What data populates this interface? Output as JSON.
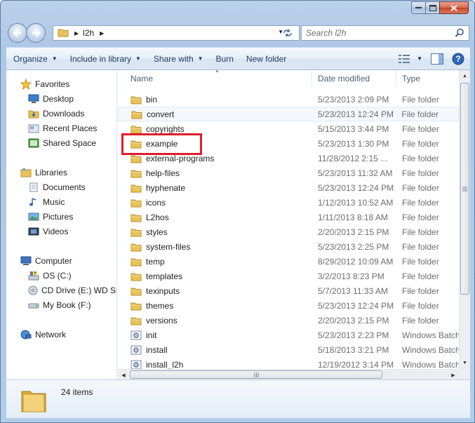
{
  "window": {
    "min_label": "▁",
    "max_label": "□",
    "close_label": "X"
  },
  "address": {
    "path_segment": "l2h"
  },
  "search": {
    "placeholder": "Search l2h"
  },
  "toolbar": {
    "organize": "Organize",
    "include_in_library": "Include in library",
    "share_with": "Share with",
    "burn": "Burn",
    "new_folder": "New folder"
  },
  "sidebar": {
    "favorites": {
      "label": "Favorites",
      "items": [
        "Desktop",
        "Downloads",
        "Recent Places",
        "Shared Space"
      ]
    },
    "libraries": {
      "label": "Libraries",
      "items": [
        "Documents",
        "Music",
        "Pictures",
        "Videos"
      ]
    },
    "computer": {
      "label": "Computer",
      "items": [
        "OS (C:)",
        "CD Drive (E:) WD Sm",
        "My Book (F:)"
      ]
    },
    "network": {
      "label": "Network"
    }
  },
  "columns": {
    "name": "Name",
    "date": "Date modified",
    "type": "Type"
  },
  "files": [
    {
      "name": "bin",
      "date": "5/23/2013 2:09 PM",
      "type": "File folder",
      "kind": "folder"
    },
    {
      "name": "convert",
      "date": "5/23/2013 12:24 PM",
      "type": "File folder",
      "kind": "folder"
    },
    {
      "name": "copyrights",
      "date": "5/15/2013 3:44 PM",
      "type": "File folder",
      "kind": "folder"
    },
    {
      "name": "example",
      "date": "5/23/2013 1:30 PM",
      "type": "File folder",
      "kind": "folder"
    },
    {
      "name": "external-programs",
      "date": "11/28/2012 2:15 ...",
      "type": "File folder",
      "kind": "folder"
    },
    {
      "name": "help-files",
      "date": "5/23/2013 11:32 AM",
      "type": "File folder",
      "kind": "folder"
    },
    {
      "name": "hyphenate",
      "date": "5/23/2013 12:24 PM",
      "type": "File folder",
      "kind": "folder"
    },
    {
      "name": "icons",
      "date": "1/12/2013 10:52 AM",
      "type": "File folder",
      "kind": "folder"
    },
    {
      "name": "L2hos",
      "date": "1/11/2013 8:18 AM",
      "type": "File folder",
      "kind": "folder"
    },
    {
      "name": "styles",
      "date": "2/20/2013 2:15 PM",
      "type": "File folder",
      "kind": "folder"
    },
    {
      "name": "system-files",
      "date": "5/23/2013 2:25 PM",
      "type": "File folder",
      "kind": "folder"
    },
    {
      "name": "temp",
      "date": "8/29/2012 10:09 AM",
      "type": "File folder",
      "kind": "folder"
    },
    {
      "name": "templates",
      "date": "3/2/2013 8:23 PM",
      "type": "File folder",
      "kind": "folder"
    },
    {
      "name": "texinputs",
      "date": "5/7/2013 11:33 AM",
      "type": "File folder",
      "kind": "folder"
    },
    {
      "name": "themes",
      "date": "5/23/2013 12:24 PM",
      "type": "File folder",
      "kind": "folder"
    },
    {
      "name": "versions",
      "date": "2/20/2013 2:15 PM",
      "type": "File folder",
      "kind": "folder"
    },
    {
      "name": "init",
      "date": "5/23/2013 2:23 PM",
      "type": "Windows Batch",
      "kind": "batch"
    },
    {
      "name": "install",
      "date": "5/18/2013 3:21 PM",
      "type": "Windows Batch",
      "kind": "batch"
    },
    {
      "name": "install_l2h",
      "date": "12/19/2012 3:14 PM",
      "type": "Windows Batch",
      "kind": "batch"
    }
  ],
  "status": {
    "item_count": "24 items"
  },
  "colors": {
    "highlight_box": "#e11d2b",
    "folder": "#e8c25a",
    "toolbar_text": "#1e395b"
  }
}
